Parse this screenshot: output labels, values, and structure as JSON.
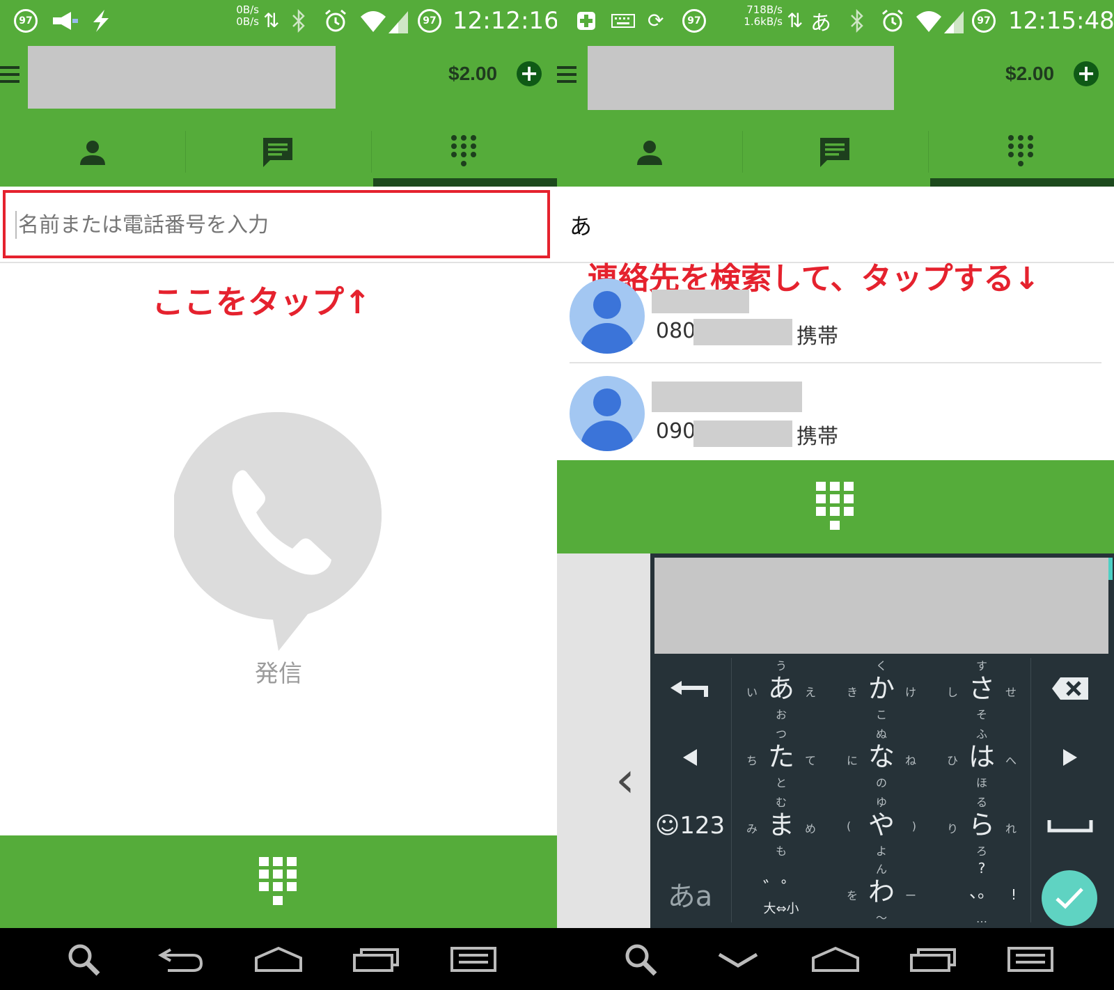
{
  "left": {
    "status": {
      "badge": "97",
      "rate_up": "0B/s",
      "rate_down": "0B/s",
      "badge2": "97",
      "time": "12:12:16"
    },
    "balance": "$2.00",
    "search_placeholder": "名前または電話番号を入力",
    "annotation": "ここをタップ↑",
    "call_label": "発信"
  },
  "right": {
    "status": {
      "badge": "97",
      "rate_up": "718B/s",
      "rate_down": "1.6kB/s",
      "ime": "あ",
      "badge2": "97",
      "time": "12:15:48"
    },
    "balance": "$2.00",
    "query": "あ",
    "annotation": "連絡先を検索して、タップする↓",
    "contacts": [
      {
        "phone_prefix": "080",
        "type": "携帯"
      },
      {
        "phone_prefix": "090",
        "type": "携帯"
      }
    ],
    "keyboard": {
      "rows": [
        [
          {
            "main": "あ",
            "up": "う",
            "down": "お",
            "left": "い",
            "right": "え"
          },
          {
            "main": "か",
            "up": "く",
            "down": "こ",
            "left": "き",
            "right": "け"
          },
          {
            "main": "さ",
            "up": "す",
            "down": "そ",
            "left": "し",
            "right": "せ"
          }
        ],
        [
          {
            "main": "た",
            "up": "つ",
            "down": "と",
            "left": "ち",
            "right": "て"
          },
          {
            "main": "な",
            "up": "ぬ",
            "down": "の",
            "left": "に",
            "right": "ね"
          },
          {
            "main": "は",
            "up": "ふ",
            "down": "ほ",
            "left": "ひ",
            "right": "へ"
          }
        ],
        [
          {
            "main": "ま",
            "up": "む",
            "down": "も",
            "left": "み",
            "right": "め"
          },
          {
            "main": "や",
            "up": "ゆ",
            "down": "よ",
            "left": "(",
            "right": ")"
          },
          {
            "main": "ら",
            "up": "る",
            "down": "ろ",
            "left": "り",
            "right": "れ"
          }
        ],
        [
          {
            "main": "゛゜",
            "up": "",
            "down": "大⇔小",
            "left": "",
            "right": ""
          },
          {
            "main": "わ",
            "up": "ん",
            "down": "〜",
            "left": "を",
            "right": "ー"
          },
          {
            "main": "、。",
            "up": "?",
            "down": "…",
            "left": "",
            "right": "!"
          }
        ]
      ],
      "emoji_num": "☺123",
      "kana_mode": "あa"
    }
  },
  "icons": {
    "contacts_tab": "person-icon",
    "messages_tab": "message-icon",
    "dialpad_tab": "dialpad-icon"
  },
  "colors": {
    "app_green": "#55ac3a",
    "annotation_red": "#e5222e",
    "avatar_blue": "#3b74d9",
    "enter_teal": "#5fd3c2"
  }
}
